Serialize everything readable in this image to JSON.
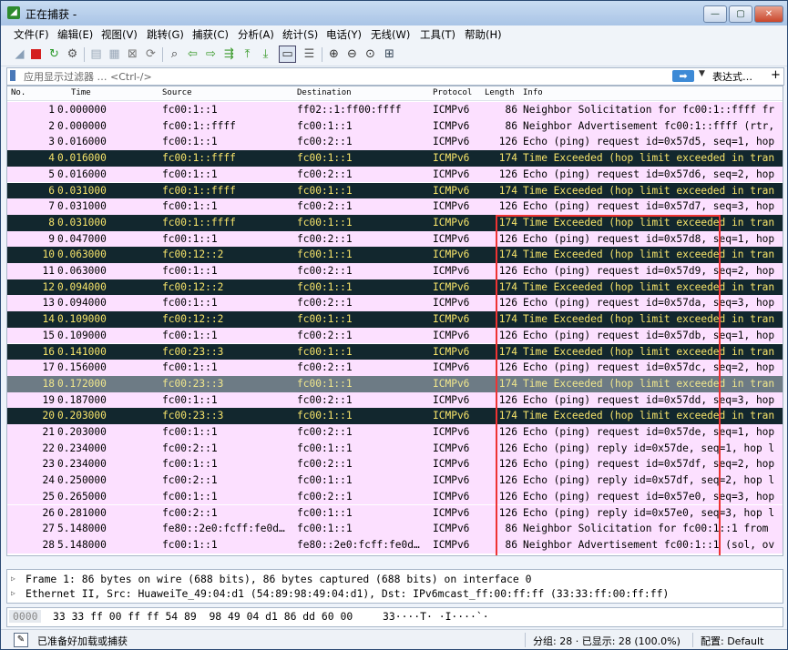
{
  "window": {
    "title": "正在捕获 -"
  },
  "window_buttons": {
    "minimize": "—",
    "maximize": "▢",
    "close": "✕"
  },
  "menu": [
    "文件(F)",
    "编辑(E)",
    "视图(V)",
    "跳转(G)",
    "捕获(C)",
    "分析(A)",
    "统计(S)",
    "电话(Y)",
    "无线(W)",
    "工具(T)",
    "帮助(H)"
  ],
  "toolbar": {
    "icons": [
      "shark-fin-start-icon",
      "stop-capture-icon",
      "restart-capture-icon",
      "capture-options-icon",
      "open-file-icon",
      "save-file-icon",
      "close-file-icon",
      "reload-icon",
      "find-packet-icon",
      "go-back-icon",
      "go-forward-icon",
      "go-to-packet-icon",
      "go-first-icon",
      "go-last-icon",
      "autoscroll-icon",
      "colorize-icon",
      "zoom-in-icon",
      "zoom-out-icon",
      "zoom-normal-icon",
      "resize-columns-icon"
    ],
    "autoscroll_active": true
  },
  "filter": {
    "placeholder": "应用显示过滤器 … <Ctrl-/>",
    "apply_label": "➡",
    "dropdown": "▼",
    "expression_label": "表达式…",
    "add_label": "+"
  },
  "packet_list": {
    "columns": [
      "No.",
      "Time",
      "Source",
      "Destination",
      "Protocol",
      "Length",
      "Info"
    ],
    "selected_no": 18,
    "rows": [
      {
        "no": "1",
        "time": "0.000000",
        "src": "fc00:1::1",
        "dst": "ff02::1:ff00:ffff",
        "proto": "ICMPv6",
        "len": "86",
        "info": "Neighbor Solicitation for fc00:1::ffff fr",
        "type": "echo"
      },
      {
        "no": "2",
        "time": "0.000000",
        "src": "fc00:1::ffff",
        "dst": "fc00:1::1",
        "proto": "ICMPv6",
        "len": "86",
        "info": "Neighbor Advertisement fc00:1::ffff (rtr,",
        "type": "echo"
      },
      {
        "no": "3",
        "time": "0.016000",
        "src": "fc00:1::1",
        "dst": "fc00:2::1",
        "proto": "ICMPv6",
        "len": "126",
        "info": "Echo (ping) request id=0x57d5, seq=1, hop",
        "type": "echo"
      },
      {
        "no": "4",
        "time": "0.016000",
        "src": "fc00:1::ffff",
        "dst": "fc00:1::1",
        "proto": "ICMPv6",
        "len": "174",
        "info": "Time Exceeded (hop limit exceeded in tran",
        "type": "exc"
      },
      {
        "no": "5",
        "time": "0.016000",
        "src": "fc00:1::1",
        "dst": "fc00:2::1",
        "proto": "ICMPv6",
        "len": "126",
        "info": "Echo (ping) request id=0x57d6, seq=2, hop",
        "type": "echo"
      },
      {
        "no": "6",
        "time": "0.031000",
        "src": "fc00:1::ffff",
        "dst": "fc00:1::1",
        "proto": "ICMPv6",
        "len": "174",
        "info": "Time Exceeded (hop limit exceeded in tran",
        "type": "exc"
      },
      {
        "no": "7",
        "time": "0.031000",
        "src": "fc00:1::1",
        "dst": "fc00:2::1",
        "proto": "ICMPv6",
        "len": "126",
        "info": "Echo (ping) request id=0x57d7, seq=3, hop",
        "type": "echo"
      },
      {
        "no": "8",
        "time": "0.031000",
        "src": "fc00:1::ffff",
        "dst": "fc00:1::1",
        "proto": "ICMPv6",
        "len": "174",
        "info": "Time Exceeded (hop limit exceeded in tran",
        "type": "exc"
      },
      {
        "no": "9",
        "time": "0.047000",
        "src": "fc00:1::1",
        "dst": "fc00:2::1",
        "proto": "ICMPv6",
        "len": "126",
        "info": "Echo (ping) request id=0x57d8, seq=1, hop",
        "type": "echo"
      },
      {
        "no": "10",
        "time": "0.063000",
        "src": "fc00:12::2",
        "dst": "fc00:1::1",
        "proto": "ICMPv6",
        "len": "174",
        "info": "Time Exceeded (hop limit exceeded in tran",
        "type": "exc"
      },
      {
        "no": "11",
        "time": "0.063000",
        "src": "fc00:1::1",
        "dst": "fc00:2::1",
        "proto": "ICMPv6",
        "len": "126",
        "info": "Echo (ping) request id=0x57d9, seq=2, hop",
        "type": "echo"
      },
      {
        "no": "12",
        "time": "0.094000",
        "src": "fc00:12::2",
        "dst": "fc00:1::1",
        "proto": "ICMPv6",
        "len": "174",
        "info": "Time Exceeded (hop limit exceeded in tran",
        "type": "exc"
      },
      {
        "no": "13",
        "time": "0.094000",
        "src": "fc00:1::1",
        "dst": "fc00:2::1",
        "proto": "ICMPv6",
        "len": "126",
        "info": "Echo (ping) request id=0x57da, seq=3, hop",
        "type": "echo"
      },
      {
        "no": "14",
        "time": "0.109000",
        "src": "fc00:12::2",
        "dst": "fc00:1::1",
        "proto": "ICMPv6",
        "len": "174",
        "info": "Time Exceeded (hop limit exceeded in tran",
        "type": "exc"
      },
      {
        "no": "15",
        "time": "0.109000",
        "src": "fc00:1::1",
        "dst": "fc00:2::1",
        "proto": "ICMPv6",
        "len": "126",
        "info": "Echo (ping) request id=0x57db, seq=1, hop",
        "type": "echo"
      },
      {
        "no": "16",
        "time": "0.141000",
        "src": "fc00:23::3",
        "dst": "fc00:1::1",
        "proto": "ICMPv6",
        "len": "174",
        "info": "Time Exceeded (hop limit exceeded in tran",
        "type": "exc"
      },
      {
        "no": "17",
        "time": "0.156000",
        "src": "fc00:1::1",
        "dst": "fc00:2::1",
        "proto": "ICMPv6",
        "len": "126",
        "info": "Echo (ping) request id=0x57dc, seq=2, hop",
        "type": "echo"
      },
      {
        "no": "18",
        "time": "0.172000",
        "src": "fc00:23::3",
        "dst": "fc00:1::1",
        "proto": "ICMPv6",
        "len": "174",
        "info": "Time Exceeded (hop limit exceeded in tran",
        "type": "exc"
      },
      {
        "no": "19",
        "time": "0.187000",
        "src": "fc00:1::1",
        "dst": "fc00:2::1",
        "proto": "ICMPv6",
        "len": "126",
        "info": "Echo (ping) request id=0x57dd, seq=3, hop",
        "type": "echo"
      },
      {
        "no": "20",
        "time": "0.203000",
        "src": "fc00:23::3",
        "dst": "fc00:1::1",
        "proto": "ICMPv6",
        "len": "174",
        "info": "Time Exceeded (hop limit exceeded in tran",
        "type": "exc"
      },
      {
        "no": "21",
        "time": "0.203000",
        "src": "fc00:1::1",
        "dst": "fc00:2::1",
        "proto": "ICMPv6",
        "len": "126",
        "info": "Echo (ping) request id=0x57de, seq=1, hop",
        "type": "echo"
      },
      {
        "no": "22",
        "time": "0.234000",
        "src": "fc00:2::1",
        "dst": "fc00:1::1",
        "proto": "ICMPv6",
        "len": "126",
        "info": "Echo (ping) reply id=0x57de, seq=1, hop l",
        "type": "echo"
      },
      {
        "no": "23",
        "time": "0.234000",
        "src": "fc00:1::1",
        "dst": "fc00:2::1",
        "proto": "ICMPv6",
        "len": "126",
        "info": "Echo (ping) request id=0x57df, seq=2, hop",
        "type": "echo"
      },
      {
        "no": "24",
        "time": "0.250000",
        "src": "fc00:2::1",
        "dst": "fc00:1::1",
        "proto": "ICMPv6",
        "len": "126",
        "info": "Echo (ping) reply id=0x57df, seq=2, hop l",
        "type": "echo"
      },
      {
        "no": "25",
        "time": "0.265000",
        "src": "fc00:1::1",
        "dst": "fc00:2::1",
        "proto": "ICMPv6",
        "len": "126",
        "info": "Echo (ping) request id=0x57e0, seq=3, hop",
        "type": "echo"
      },
      {
        "no": "26",
        "time": "0.281000",
        "src": "fc00:2::1",
        "dst": "fc00:1::1",
        "proto": "ICMPv6",
        "len": "126",
        "info": "Echo (ping) reply id=0x57e0, seq=3, hop l",
        "type": "echo"
      },
      {
        "no": "27",
        "time": "5.148000",
        "src": "fe80::2e0:fcff:fe0d…",
        "dst": "fc00:1::1",
        "proto": "ICMPv6",
        "len": "86",
        "info": "Neighbor Solicitation for fc00:1::1 from",
        "type": "echo"
      },
      {
        "no": "28",
        "time": "5.148000",
        "src": "fc00:1::1",
        "dst": "fe80::2e0:fcff:fe0d…",
        "proto": "ICMPv6",
        "len": "86",
        "info": "Neighbor Advertisement fc00:1::1 (sol, ov",
        "type": "echo"
      }
    ]
  },
  "details": [
    "Frame 1: 86 bytes on wire (688 bits), 86 bytes captured (688 bits) on interface 0",
    "Ethernet II, Src: HuaweiTe_49:04:d1 (54:89:98:49:04:d1), Dst: IPv6mcast_ff:00:ff:ff (33:33:ff:00:ff:ff)"
  ],
  "detail_toggle": "▷",
  "bytes": {
    "offset": "0000",
    "hex": "33 33 ff 00 ff ff 54 89  98 49 04 d1 86 dd 60 00",
    "ascii": "33····T· ·I····`·"
  },
  "status": {
    "icon": "✎",
    "message": "已准备好加载或捕获",
    "packets": "分组: 28 · 已显示: 28 (100.0%)",
    "profile": "配置: Default"
  },
  "colors": {
    "echo_row_bg": "#fce0ff",
    "exceeded_row_bg": "#12272e",
    "exceeded_row_fg": "#f7e46a",
    "selected_row_bg": "#6d7b85",
    "annotation_box": "#e33333"
  }
}
